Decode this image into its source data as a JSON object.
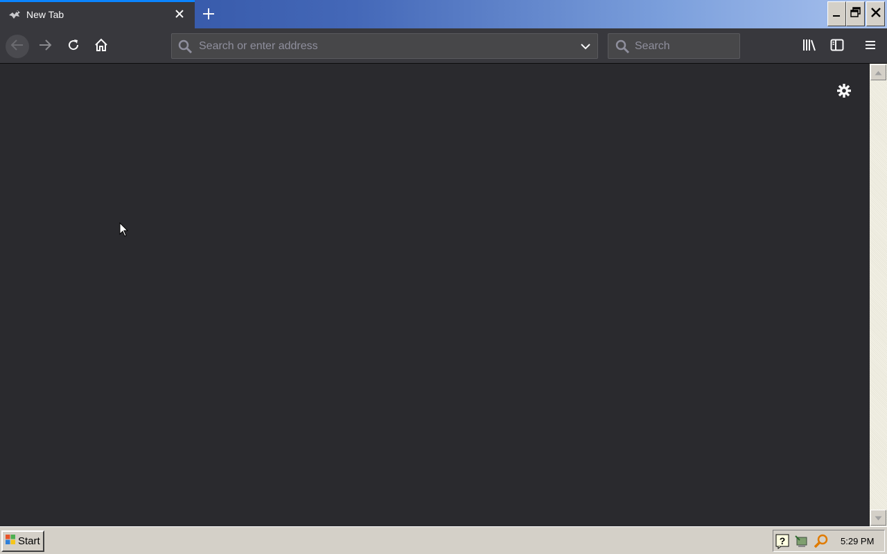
{
  "tab": {
    "title": "New Tab",
    "favicon": "tab-favicon-icon",
    "close_icon": "close-icon"
  },
  "window_controls": [
    "minimize-icon",
    "restore-icon",
    "close-icon"
  ],
  "toolbar": {
    "back_icon": "back-arrow-icon",
    "forward_icon": "forward-arrow-icon",
    "reload_icon": "reload-icon",
    "home_icon": "home-icon",
    "urlbar_placeholder": "Search or enter address",
    "urlbar_value": "",
    "search_placeholder": "Search",
    "library_icon": "library-icon",
    "sidebar_icon": "sidebar-icon",
    "menu_icon": "hamburger-menu-icon"
  },
  "content": {
    "settings_icon": "gear-icon"
  },
  "taskbar": {
    "start_label": "Start",
    "clock": "5:29 PM",
    "tray_icons": [
      "help-icon",
      "network-icon",
      "search-magnifier-icon"
    ]
  },
  "colors": {
    "accent": "#0a84ff",
    "toolbar_bg": "#38383d",
    "content_bg": "#2a2a2e",
    "taskbar_bg": "#d4d0c8"
  }
}
